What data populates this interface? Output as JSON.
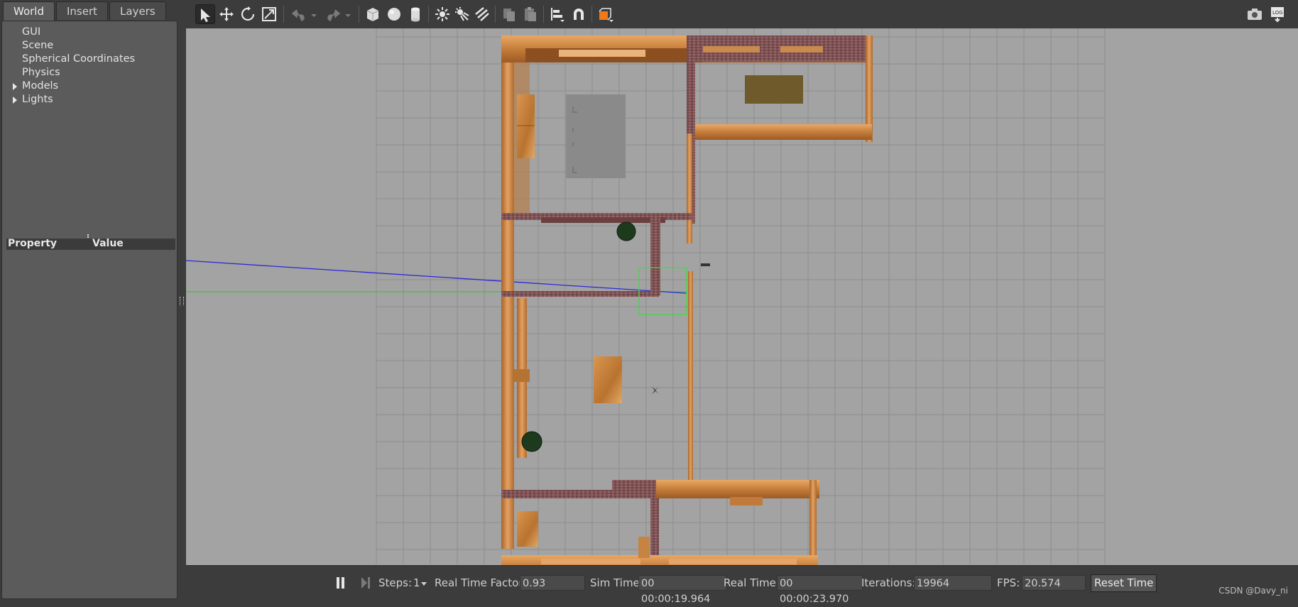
{
  "tabs": [
    "World",
    "Insert",
    "Layers"
  ],
  "world_tree": [
    {
      "label": "GUI",
      "expandable": false
    },
    {
      "label": "Scene",
      "expandable": false
    },
    {
      "label": "Spherical Coordinates",
      "expandable": false
    },
    {
      "label": "Physics",
      "expandable": false
    },
    {
      "label": "Models",
      "expandable": true
    },
    {
      "label": "Lights",
      "expandable": true
    }
  ],
  "property_header": {
    "property": "Property",
    "value": "Value"
  },
  "toolbar_icons": [
    "select-arrow-icon",
    "translate-icon",
    "rotate-icon",
    "scale-icon",
    "undo-icon",
    "undo-history-icon",
    "redo-icon",
    "redo-history-icon",
    "box-icon",
    "sphere-icon",
    "cylinder-icon",
    "point-light-icon",
    "spot-light-icon",
    "directional-light-icon",
    "copy-icon",
    "paste-icon",
    "align-icon",
    "snap-icon",
    "view-angle-icon",
    "screenshot-icon",
    "log-icon"
  ],
  "bottom_bar": {
    "steps_label": "Steps:",
    "steps_value": "1",
    "rtf_label": "Real Time Factor:",
    "rtf_value": "0.93",
    "sim_time_label": "Sim Time:",
    "sim_time_value": "00 00:00:19.964",
    "real_time_label": "Real Time:",
    "real_time_value": "00 00:00:23.970",
    "iterations_label": "Iterations:",
    "iterations_value": "19964",
    "fps_label": "FPS:",
    "fps_value": "20.574",
    "reset_label": "Reset Time"
  },
  "watermark": "CSDN @Davy_ni",
  "colors": {
    "viewport_bg": "#a3a3a3",
    "wood": "#c98a45",
    "brick": "#8b5a5a",
    "selection": "#33cc33",
    "ray": "#2b2bd6",
    "plant": "#1f3d1f"
  }
}
